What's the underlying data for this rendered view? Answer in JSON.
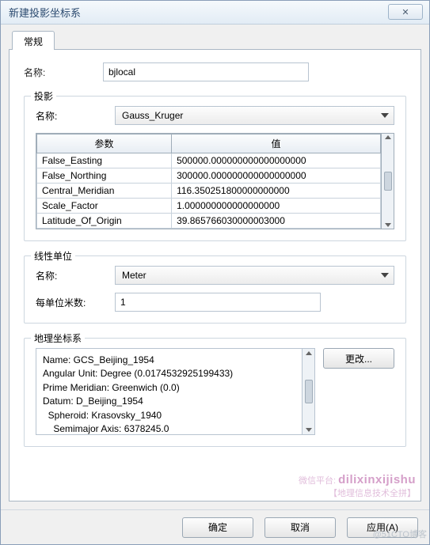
{
  "window": {
    "title": "新建投影坐标系",
    "close_glyph": "✕"
  },
  "tab": {
    "label": "常规"
  },
  "name": {
    "label": "名称:",
    "value": "bjlocal"
  },
  "projection": {
    "group_title": "投影",
    "name_label": "名称:",
    "name_value": "Gauss_Kruger",
    "param_header": "参数",
    "value_header": "值",
    "rows": [
      {
        "param": "False_Easting",
        "value": "500000.000000000000000000"
      },
      {
        "param": "False_Northing",
        "value": "300000.000000000000000000"
      },
      {
        "param": "Central_Meridian",
        "value": "116.350251800000000000"
      },
      {
        "param": "Scale_Factor",
        "value": "1.000000000000000000"
      },
      {
        "param": "Latitude_Of_Origin",
        "value": "39.865766030000003000"
      }
    ]
  },
  "linear_unit": {
    "group_title": "线性单位",
    "name_label": "名称:",
    "name_value": "Meter",
    "per_label": "每单位米数:",
    "per_value": "1"
  },
  "gcs": {
    "group_title": "地理坐标系",
    "change_btn": "更改...",
    "lines": [
      "Name: GCS_Beijing_1954",
      "Angular Unit: Degree (0.0174532925199433)",
      "Prime Meridian: Greenwich (0.0)",
      "Datum: D_Beijing_1954",
      "  Spheroid: Krasovsky_1940",
      "    Semimajor Axis: 6378245.0"
    ]
  },
  "footer": {
    "ok": "确定",
    "cancel": "取消",
    "apply": "应用(A)"
  },
  "watermark": {
    "label": "微信平台:",
    "brand": "dilixinxijishu",
    "sub": "【地理信息技术全拼】",
    "corner": "@51CTO博客"
  }
}
